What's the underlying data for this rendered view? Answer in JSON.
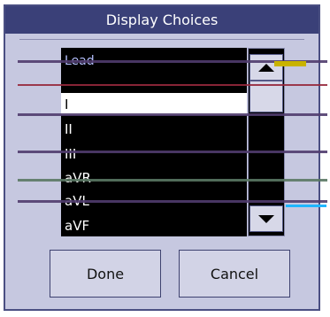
{
  "dialog": {
    "title": "Display Choices"
  },
  "list": {
    "header": "Lead",
    "items": [
      {
        "label": "I",
        "selected": true
      },
      {
        "label": "II",
        "selected": false
      },
      {
        "label": "III",
        "selected": false
      },
      {
        "label": "aVR",
        "selected": false
      },
      {
        "label": "aVL",
        "selected": false
      },
      {
        "label": "aVF",
        "selected": false
      }
    ]
  },
  "buttons": {
    "done": "Done",
    "cancel": "Cancel"
  },
  "icons": {
    "scroll_up": "triangle-up-icon",
    "scroll_down": "triangle-down-icon"
  },
  "colors": {
    "title_bar": "#3a4078",
    "dialog_bg": "#c6c8e0",
    "list_bg": "#000000",
    "selection_bg": "#ffffff",
    "header_text": "#b6c0ff"
  }
}
